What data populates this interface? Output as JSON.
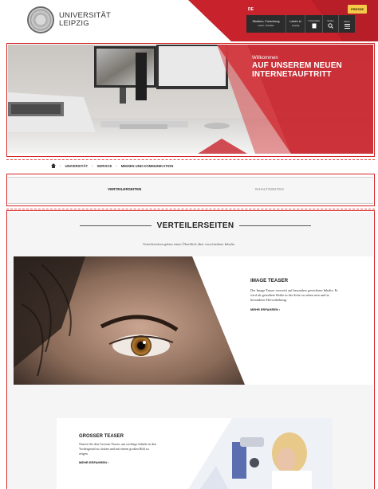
{
  "header": {
    "logo_line1": "UNIVERSITÄT",
    "logo_line2": "LEIPZIG",
    "lang": "DE",
    "nav": [
      {
        "label": "Studium, Forschung",
        "sub": "Lehre, Transfer"
      },
      {
        "label": "Leben in",
        "sub": "Leipzig"
      },
      {
        "label": "Universität",
        "sub": ""
      },
      {
        "label": "Suche",
        "sub": ""
      },
      {
        "label": "Menü",
        "sub": ""
      }
    ],
    "presse": "PRESSE"
  },
  "hero": {
    "kicker": "Willkommen",
    "title": "AUF UNSEREM NEUEN INTERNETAUFTRITT"
  },
  "breadcrumb": [
    "UNIVERSITÄT",
    "SERVICE",
    "MEDIEN UND KOMMUNIKATION"
  ],
  "tabs": [
    "VERTEILERSEITEN",
    "INHALTSSEITEN"
  ],
  "section": {
    "title": "VERTEILERSEITEN",
    "subtitle": "Verteilerseiten geben einen Überblick über verschiedene Inhalte."
  },
  "image_teaser": {
    "title": "IMAGE TEASER",
    "text": "Der Image Teaser verweist auf besonders gewichtete Inhalte. Er wird als gestaltete Reihe in der Seite zu sehen sein und in besonderer Hervorhebung.",
    "link": "MEHR ERFAHREN  ›"
  },
  "large_teaser": {
    "title": "GROSSER TEASER",
    "text": "Nutzen Sie den Grossen Teaser, um wichtige Inhalte in den Vordergrund zu rücken und mit einem großen Bild zu zeigen.",
    "link": "MEHR ERFAHREN  ›"
  },
  "colors": {
    "brand_red": "#c8232c",
    "presse_yellow": "#f6c94a",
    "nav_dark": "#2c2c2c"
  }
}
